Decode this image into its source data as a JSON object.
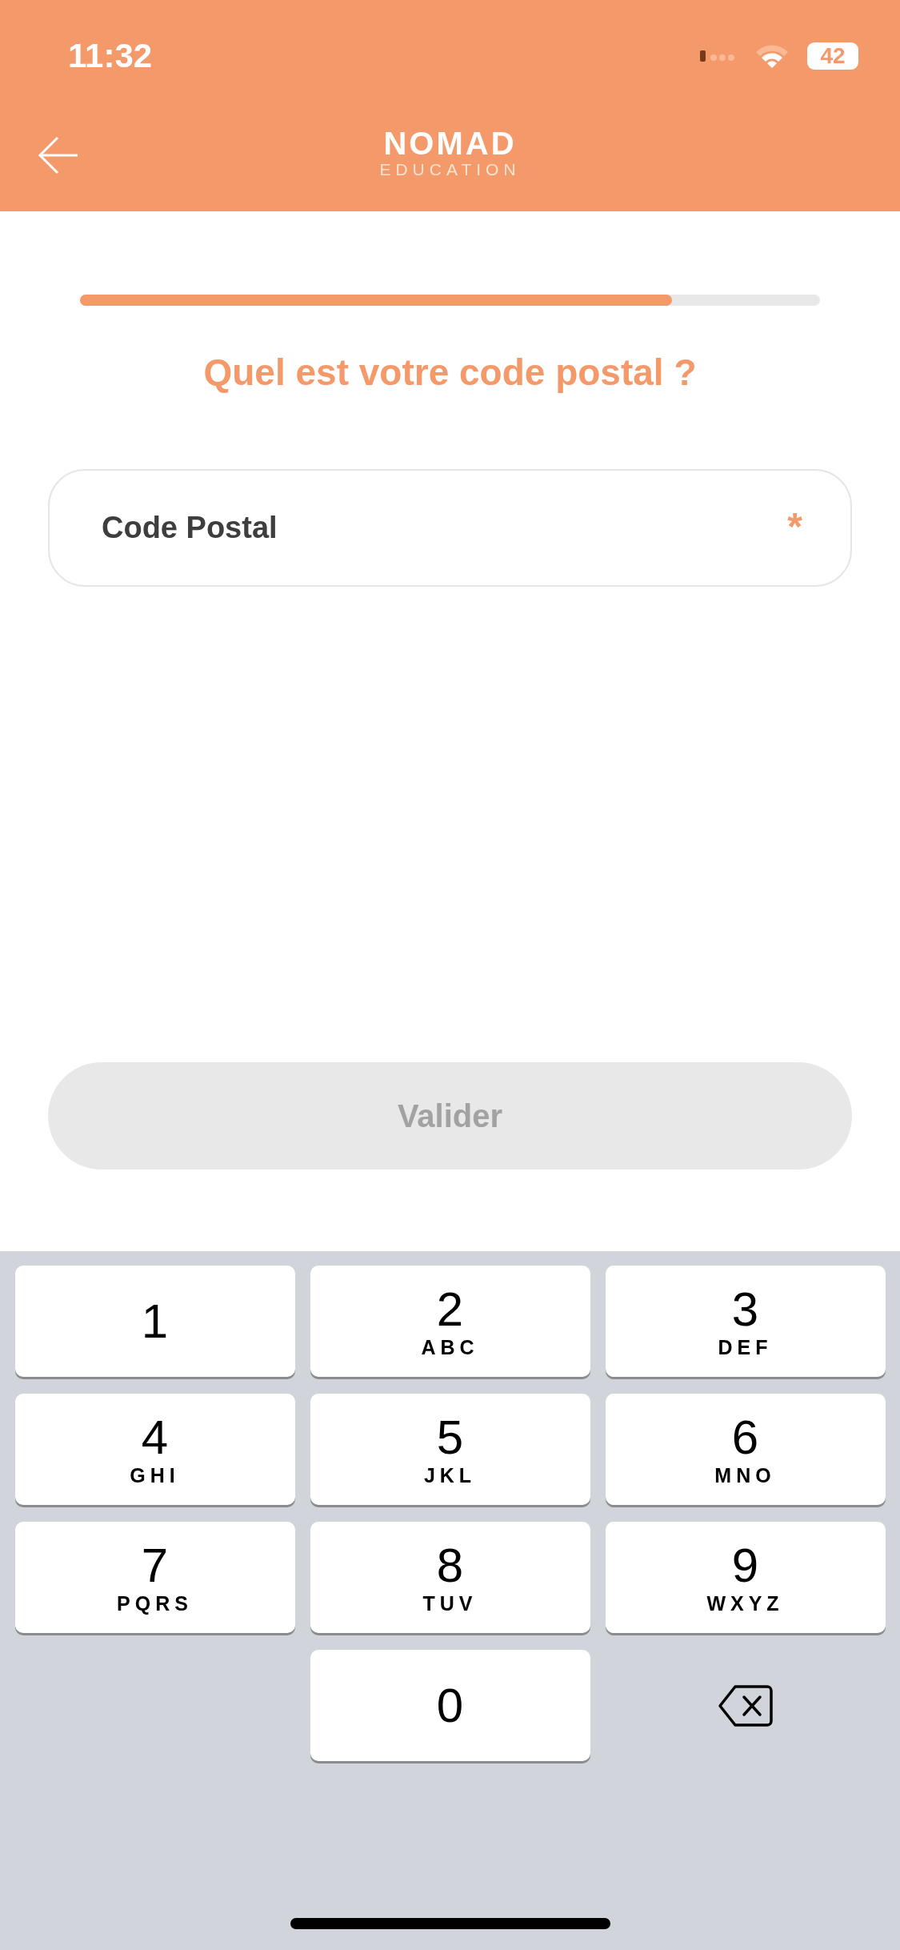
{
  "status_bar": {
    "time": "11:32",
    "battery": "42"
  },
  "header": {
    "logo": {
      "name": "NOMAD",
      "tagline": "EDUCATION"
    }
  },
  "progress": {
    "level": 0.8
  },
  "question": "Quel est votre code postal ?",
  "field": {
    "placeholder": "Code Postal",
    "required_mark": "*"
  },
  "submit_button": {
    "label": "Valider",
    "disabled": true
  },
  "keypad": [
    {
      "kind": "digit",
      "digit": "1"
    },
    {
      "kind": "digit",
      "digit": "2",
      "letters": "ABC"
    },
    {
      "kind": "digit",
      "digit": "3",
      "letters": "DEF"
    },
    {
      "kind": "digit",
      "digit": "4",
      "letters": "GHI"
    },
    {
      "kind": "digit",
      "digit": "5",
      "letters": "JKL"
    },
    {
      "kind": "digit",
      "digit": "6",
      "letters": "MNO"
    },
    {
      "kind": "digit",
      "digit": "7",
      "letters": "PQRS"
    },
    {
      "kind": "digit",
      "digit": "8",
      "letters": "TUV"
    },
    {
      "kind": "digit",
      "digit": "9",
      "letters": "WXYZ"
    },
    {
      "kind": "blank"
    },
    {
      "kind": "digit",
      "digit": "0"
    },
    {
      "kind": "delete"
    }
  ]
}
